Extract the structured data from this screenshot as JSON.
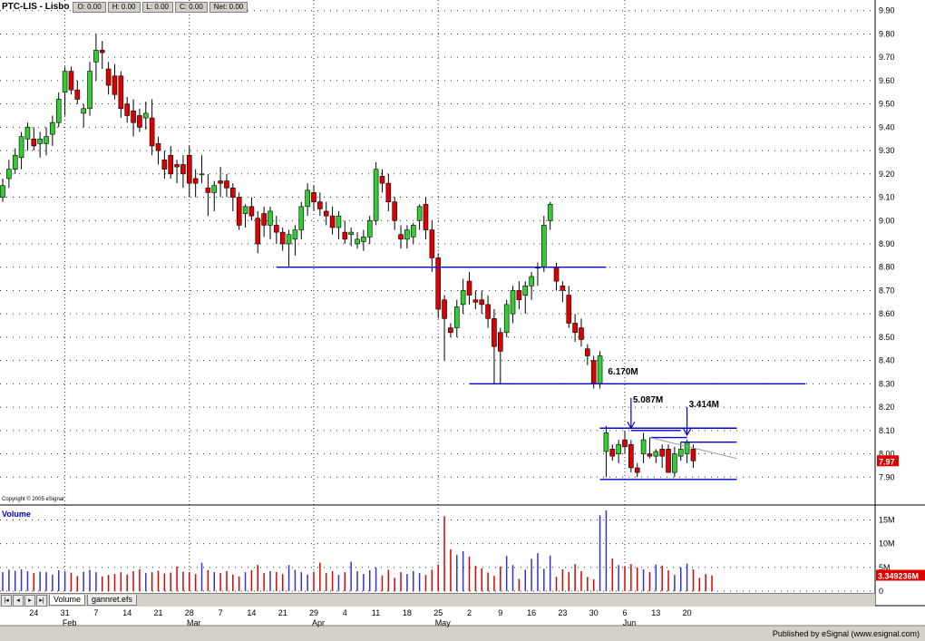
{
  "window": {
    "symbol": "PTC-LIS - Lisbo",
    "ohlc": [
      "O: 0.00",
      "H: 0.00",
      "L: 0.00",
      "C: 0.00",
      "Net: 0.00"
    ],
    "copyright": "Copyright © 2005 eSignal",
    "volume_title": "Volume",
    "tabs": [
      "Volume",
      "gannret.efs"
    ],
    "footer": "Published by eSignal (www.esignal.com)"
  },
  "colors": {
    "up": "#33cc33",
    "down": "#dd0000",
    "line": "#0000cc",
    "grid": "#333333",
    "price_badge": "#dd0000",
    "volume_badge": "#dd0000"
  },
  "chart_data": [
    {
      "type": "candlestick",
      "title": "PTC-LIS",
      "ylim": [
        7.8,
        9.93
      ],
      "yticks": [
        "9.90",
        "9.80",
        "9.70",
        "9.60",
        "9.50",
        "9.40",
        "9.30",
        "9.20",
        "9.10",
        "9.00",
        "8.90",
        "8.80",
        "8.70",
        "8.60",
        "8.50",
        "8.40",
        "8.30",
        "8.20",
        "8.10",
        "8.00",
        "7.90"
      ],
      "last_price": "7.97",
      "x_day_labels": [
        "24",
        "31",
        "7",
        "14",
        "21",
        "28",
        "7",
        "14",
        "21",
        "29",
        "4",
        "11",
        "18",
        "25",
        "2",
        "9",
        "16",
        "23",
        "30",
        "6",
        "13",
        "20"
      ],
      "x_month_labels": [
        "Feb",
        "Mar",
        "Apr",
        "May",
        "Jun"
      ],
      "candles": [
        [
          9.1,
          9.18,
          9.08,
          9.15
        ],
        [
          9.18,
          9.26,
          9.14,
          9.22
        ],
        [
          9.22,
          9.31,
          9.2,
          9.28
        ],
        [
          9.27,
          9.38,
          9.22,
          9.36
        ],
        [
          9.35,
          9.42,
          9.3,
          9.4
        ],
        [
          9.35,
          9.4,
          9.3,
          9.32
        ],
        [
          9.33,
          9.38,
          9.27,
          9.35
        ],
        [
          9.33,
          9.4,
          9.28,
          9.36
        ],
        [
          9.37,
          9.45,
          9.32,
          9.42
        ],
        [
          9.42,
          9.55,
          9.4,
          9.52
        ],
        [
          9.55,
          9.66,
          9.45,
          9.64
        ],
        [
          9.64,
          9.66,
          9.54,
          9.56
        ],
        [
          9.56,
          9.6,
          9.5,
          9.52
        ],
        [
          9.46,
          9.5,
          9.4,
          9.48
        ],
        [
          9.48,
          9.68,
          9.45,
          9.64
        ],
        [
          9.68,
          9.8,
          9.6,
          9.73
        ],
        [
          9.73,
          9.77,
          9.65,
          9.72
        ],
        [
          9.65,
          9.68,
          9.54,
          9.58
        ],
        [
          9.62,
          9.67,
          9.52,
          9.54
        ],
        [
          9.62,
          9.64,
          9.44,
          9.48
        ],
        [
          9.5,
          9.53,
          9.42,
          9.45
        ],
        [
          9.47,
          9.52,
          9.36,
          9.42
        ],
        [
          9.45,
          9.48,
          9.38,
          9.4
        ],
        [
          9.44,
          9.51,
          9.39,
          9.46
        ],
        [
          9.44,
          9.52,
          9.28,
          9.32
        ],
        [
          9.33,
          9.36,
          9.24,
          9.3
        ],
        [
          9.26,
          9.3,
          9.18,
          9.22
        ],
        [
          9.28,
          9.32,
          9.18,
          9.2
        ],
        [
          9.24,
          9.26,
          9.16,
          9.23
        ],
        [
          9.24,
          9.28,
          9.14,
          9.2
        ],
        [
          9.28,
          9.32,
          9.1,
          9.16
        ],
        [
          9.18,
          9.22,
          9.1,
          9.16
        ],
        [
          9.2,
          9.28,
          9.16,
          9.2
        ],
        [
          9.14,
          9.2,
          9.02,
          9.12
        ],
        [
          9.12,
          9.17,
          9.04,
          9.15
        ],
        [
          9.17,
          9.23,
          9.1,
          9.16
        ],
        [
          9.17,
          9.2,
          9.1,
          9.14
        ],
        [
          9.14,
          9.16,
          9.04,
          9.1
        ],
        [
          9.1,
          9.12,
          8.96,
          8.98
        ],
        [
          9.03,
          9.07,
          8.97,
          9.06
        ],
        [
          9.06,
          9.1,
          9.0,
          9.02
        ],
        [
          9.01,
          9.04,
          8.86,
          8.9
        ],
        [
          9.03,
          9.06,
          8.93,
          8.98
        ],
        [
          8.98,
          9.06,
          8.92,
          9.04
        ],
        [
          8.98,
          9.02,
          8.9,
          8.95
        ],
        [
          8.95,
          8.97,
          8.87,
          8.9
        ],
        [
          8.9,
          8.96,
          8.8,
          8.94
        ],
        [
          8.92,
          8.98,
          8.85,
          8.96
        ],
        [
          8.96,
          9.08,
          8.92,
          9.06
        ],
        [
          9.06,
          9.16,
          9.02,
          9.13
        ],
        [
          9.12,
          9.15,
          9.04,
          9.08
        ],
        [
          9.08,
          9.12,
          9.02,
          9.05
        ],
        [
          9.04,
          9.08,
          8.98,
          9.02
        ],
        [
          9.02,
          9.06,
          8.94,
          8.97
        ],
        [
          8.97,
          9.04,
          8.92,
          9.02
        ],
        [
          8.95,
          9.0,
          8.9,
          8.92
        ],
        [
          8.94,
          8.97,
          8.89,
          8.95
        ],
        [
          8.9,
          8.95,
          8.88,
          8.92
        ],
        [
          8.91,
          8.96,
          8.87,
          8.93
        ],
        [
          8.93,
          9.02,
          8.9,
          9.0
        ],
        [
          9.0,
          9.25,
          8.98,
          9.22
        ],
        [
          9.19,
          9.22,
          9.12,
          9.16
        ],
        [
          9.16,
          9.2,
          9.04,
          9.08
        ],
        [
          9.08,
          9.1,
          8.96,
          9.0
        ],
        [
          8.94,
          8.98,
          8.88,
          8.92
        ],
        [
          8.92,
          8.98,
          8.88,
          8.96
        ],
        [
          8.93,
          8.99,
          8.9,
          8.98
        ],
        [
          9.0,
          9.07,
          8.96,
          9.06
        ],
        [
          9.07,
          9.1,
          8.92,
          8.96
        ],
        [
          8.96,
          9.0,
          8.78,
          8.84
        ],
        [
          8.84,
          8.86,
          8.58,
          8.62
        ],
        [
          8.66,
          8.68,
          8.4,
          8.58
        ],
        [
          8.54,
          8.56,
          8.5,
          8.52
        ],
        [
          8.54,
          8.66,
          8.5,
          8.63
        ],
        [
          8.64,
          8.75,
          8.6,
          8.7
        ],
        [
          8.74,
          8.78,
          8.64,
          8.68
        ],
        [
          8.66,
          8.7,
          8.62,
          8.65
        ],
        [
          8.66,
          8.7,
          8.6,
          8.64
        ],
        [
          8.64,
          8.68,
          8.54,
          8.58
        ],
        [
          8.58,
          8.62,
          8.3,
          8.46
        ],
        [
          8.52,
          8.54,
          8.3,
          8.44
        ],
        [
          8.52,
          8.66,
          8.5,
          8.64
        ],
        [
          8.6,
          8.72,
          8.56,
          8.7
        ],
        [
          8.7,
          8.74,
          8.62,
          8.66
        ],
        [
          8.68,
          8.74,
          8.6,
          8.72
        ],
        [
          8.72,
          8.78,
          8.66,
          8.76
        ],
        [
          8.8,
          8.82,
          8.72,
          8.8
        ],
        [
          8.8,
          9.02,
          8.78,
          8.98
        ],
        [
          9.0,
          9.08,
          8.96,
          9.07
        ],
        [
          8.8,
          8.82,
          8.7,
          8.74
        ],
        [
          8.72,
          8.74,
          8.65,
          8.7
        ],
        [
          8.68,
          8.72,
          8.54,
          8.56
        ],
        [
          8.56,
          8.6,
          8.48,
          8.52
        ],
        [
          8.54,
          8.58,
          8.46,
          8.49
        ],
        [
          8.45,
          8.47,
          8.38,
          8.42
        ],
        [
          8.4,
          8.42,
          8.28,
          8.3
        ],
        [
          8.3,
          8.44,
          8.28,
          8.42
        ],
        [
          8.01,
          8.12,
          7.9,
          8.09
        ],
        [
          8.02,
          8.04,
          7.97,
          7.99
        ],
        [
          8.0,
          8.06,
          7.96,
          8.04
        ],
        [
          8.06,
          8.1,
          8.0,
          8.03
        ],
        [
          8.04,
          8.06,
          7.92,
          7.94
        ],
        [
          7.94,
          7.96,
          7.9,
          7.92
        ],
        [
          8.0,
          8.09,
          7.96,
          8.06
        ],
        [
          8.0,
          8.07,
          7.98,
          7.99
        ],
        [
          7.99,
          8.02,
          7.96,
          8.01
        ],
        [
          8.02,
          8.04,
          7.94,
          7.99
        ],
        [
          8.02,
          8.04,
          7.92,
          7.92
        ],
        [
          7.92,
          8.03,
          7.9,
          8.0
        ],
        [
          7.99,
          8.05,
          7.97,
          8.02
        ],
        [
          8.0,
          8.06,
          7.96,
          8.05
        ],
        [
          8.02,
          8.04,
          7.94,
          7.97
        ]
      ],
      "support_resistance": [
        {
          "from": 44,
          "to": 97,
          "price": 8.8
        },
        {
          "from": 75,
          "to": 129,
          "price": 8.3
        },
        {
          "from": 96,
          "to": 118,
          "price": 8.11
        },
        {
          "from": 101,
          "to": 109,
          "price": 8.1
        },
        {
          "from": 104,
          "to": 110,
          "price": 8.07
        },
        {
          "from": 109,
          "to": 118,
          "price": 8.05
        },
        {
          "from": 96,
          "to": 118,
          "price": 7.89
        }
      ],
      "trend_line": {
        "from": 104,
        "to": 118,
        "price_from": 8.07,
        "price_to": 7.98
      },
      "annotations": [
        {
          "text": "6.170M",
          "index": 97,
          "price": 8.34,
          "arrow": false
        },
        {
          "text": "5.087M",
          "index": 101,
          "price": 8.22,
          "arrow": true,
          "arrow_from": 8.24,
          "arrow_to": 8.11
        },
        {
          "text": "3.414M",
          "index": 110,
          "price": 8.2,
          "arrow": true,
          "arrow_from": 8.2,
          "arrow_to": 8.08
        }
      ]
    },
    {
      "type": "bar",
      "title": "Volume",
      "ylim": [
        0,
        17
      ],
      "yticks": [
        "15M",
        "10M",
        "5M",
        "0"
      ],
      "last_volume": "3.349236M",
      "values": [
        4.0,
        4.5,
        4.3,
        4.6,
        4.2,
        3.8,
        4.1,
        4.0,
        3.5,
        4.4,
        4.2,
        3.9,
        3.2,
        4.1,
        4.5,
        4.0,
        3.1,
        3.4,
        3.6,
        4.0,
        3.5,
        4.2,
        4.6,
        3.8,
        4.0,
        4.3,
        3.7,
        3.9,
        5.2,
        4.1,
        4.0,
        3.6,
        6.0,
        4.4,
        4.0,
        3.8,
        4.2,
        3.5,
        3.1,
        4.0,
        4.4,
        5.5,
        3.8,
        4.2,
        4.0,
        3.6,
        5.5,
        4.5,
        4.0,
        3.5,
        4.1,
        6.0,
        3.8,
        4.2,
        3.4,
        4.0,
        6.2,
        4.2,
        3.6,
        4.4,
        5.0,
        3.3,
        4.5,
        2.8,
        4.0,
        3.6,
        4.2,
        3.8,
        3.4,
        4.5,
        5.6,
        15.8,
        8.8,
        7.6,
        8.4,
        7.3,
        5.3,
        4.8,
        3.9,
        3.2,
        5.2,
        7.4,
        5.5,
        2.6,
        4.5,
        6.8,
        8.0,
        4.7,
        7.5,
        3.0,
        4.6,
        4.0,
        5.7,
        4.2,
        3.0,
        2.5,
        16.0,
        17.0,
        6.9,
        5.5,
        5.2,
        5.7,
        5.0,
        4.6,
        4.0,
        5.6,
        5.4,
        4.4,
        3.4,
        5.0,
        5.8,
        4.6,
        2.8,
        3.6,
        3.3
      ]
    }
  ]
}
